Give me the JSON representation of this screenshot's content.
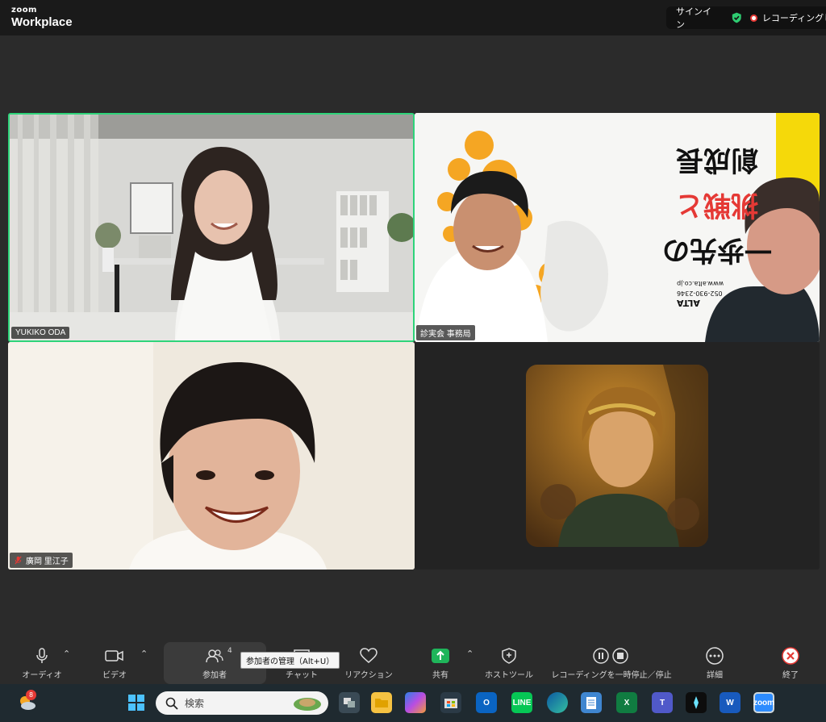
{
  "app": {
    "brand_top": "zoom",
    "brand_main": "Workplace",
    "signin_label": "サインイン",
    "recording_status": "レコーディングし"
  },
  "participants": [
    {
      "name": "YUKIKO ODA",
      "muted": false,
      "active_speaker": true
    },
    {
      "name": "診実会 事務局",
      "muted": false,
      "active_speaker": false
    },
    {
      "name": "廣岡 里江子",
      "muted": true,
      "active_speaker": false
    },
    {
      "name": "",
      "muted": false,
      "active_speaker": false,
      "avatar": "avatar-image"
    }
  ],
  "slide": {
    "line1": "一歩先の",
    "line2": "挑戦と",
    "line3": "創成長",
    "phone": "052-930-2346",
    "url": "www.alta.co.jp",
    "logo": "ALTA"
  },
  "toolbar": {
    "audio": "オーディオ",
    "video": "ビデオ",
    "participants": "参加者",
    "participants_count": "4",
    "participants_tooltip": "参加者の管理（Alt+U）",
    "chat": "チャット",
    "reactions": "リアクション",
    "share": "共有",
    "host_tools": "ホストツール",
    "recording": "レコーディングを一時停止／停止",
    "more": "詳細",
    "end": "終了"
  },
  "taskbar": {
    "weather_badge": "8",
    "search_placeholder": "検索",
    "apps": [
      "task-view",
      "file-explorer",
      "copilot",
      "store",
      "outlook",
      "line",
      "edge",
      "notepad",
      "excel",
      "teams",
      "app-dark",
      "word",
      "zoom"
    ]
  },
  "colors": {
    "active_border": "#2ed47a",
    "share_green": "#1fb55a",
    "end_red": "#e53935"
  }
}
